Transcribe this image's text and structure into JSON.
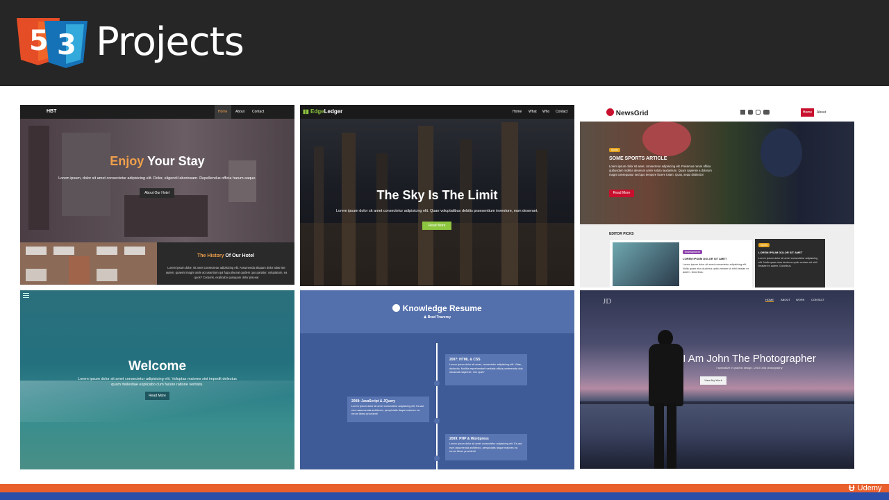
{
  "header": {
    "title": "Projects",
    "logo_html": "5",
    "logo_css": "3"
  },
  "tiles": {
    "hbt": {
      "brand": "HBT",
      "nav": [
        "Home",
        "About",
        "Contact"
      ],
      "hero_accent": "Enjoy",
      "hero_rest": "Your Stay",
      "hero_sub": "Lorem ipsum, dolor sit amet consectetur adipisicing elit. Dolor, eligendi laboriosam. Repellendus officia harum eaque.",
      "button": "About Our Hotel",
      "history_accent": "The History",
      "history_rest": "Of Our Hotel",
      "history_body": "Lorem ipsum dolor, sit amet consectetur adipisicing elit. Assumenda aliquam dolor alias iste autem, quaerat magni unde accusantium qui fuga placeat quidem quo pariatur, voluptatum, ea quos? Corporis, explicabo quisquam dolor placeat"
    },
    "edgeledger": {
      "brand_a": "Edge",
      "brand_b": "Ledger",
      "nav": [
        "Home",
        "What",
        "Who",
        "Contact"
      ],
      "hero": "The Sky Is The Limit",
      "hero_sub": "Lorem ipsum dolor sit amet consectetur adipisicing elit. Quae voluptatibus debitis praesentium inventore, eum deserunt.",
      "button": "Read More"
    },
    "newsgrid": {
      "brand": "NewsGrid",
      "nav_home": "Home",
      "nav_about": "About",
      "tag": "Sports",
      "headline": "SOME SPORTS ARTICLE",
      "body": "Lorem ipsum dolor sit amet, consectetur adipisicing elit. Possimus rerum officia quibusdam mollitia deserunt animi soluta laudantium. Quam sapiente a dolorum magni consequatur sed quo tempore facere totam. Quas, sequi distinctio!",
      "button": "Read More",
      "editor_picks": "EDITOR PICKS",
      "card1_tag": "Entertainment",
      "card1_title": "LOREM IPSUM DOLOR SIT AMET",
      "card1_body": "Lorem ipsum dolor sit amet consectetur adipisicing elit. Nulla quam eius ducimus optio veniam sit nihil beatae ex autem. Doloribus.",
      "card2_tag": "Sports",
      "card2_title": "LOREM IPSUM DOLOR SIT AMET",
      "card2_body": "Lorem ipsum dolor sit amet consectetur adipisicing elit. Nulla quam eius ducimus optio veniam sit nihil beatae ex autem. Doloribus."
    },
    "welcome": {
      "hero": "Welcome",
      "hero_sub": "Lorem ipsum dolor sit amet consectetur adipisicing elit. Voluptas maiores sint impedit delectus quam molestiae explicabo cum facere ratione veritatis.",
      "button": "Read More"
    },
    "resume": {
      "title": "Knowledge Resume",
      "author": "Brad Traversy",
      "entries": [
        {
          "title": "2007: HTML & CSS",
          "body": "Lorem ipsum dolor sit amet, consectetur adipisicing elit. Vitae, distinctio. Mollitia reprehenderit veritatis officia perferendis dolo obcaecati sapiente, rem quia?"
        },
        {
          "title": "2008: JavaScript & JQuery",
          "body": "Lorem ipsum dolor sit amet consectetur adipisicing elit. Ea aut eum assumenda architecto, perspiciatis itaque maiores ea rerum libero provident!"
        },
        {
          "title": "2009: PHP & Wordpress",
          "body": "Lorem ipsum dolor sit amet consectetur adipisicing elit. Ea aut eum assumenda architecto, perspiciatis itaque maiores ea rerum libero provident!"
        }
      ]
    },
    "photographer": {
      "brand": "JD",
      "nav": [
        "HOME",
        "ABOUT",
        "WORK",
        "CONTACT"
      ],
      "hero": "I Am John The Photographer",
      "hero_sub": "I specialize in graphic design, UI/UX and photography",
      "button": "View My Work"
    }
  },
  "footer": {
    "brand": "Udemy"
  },
  "colors": {
    "header_bg": "#262626",
    "html5": "#e44d26",
    "css3": "#2965f1",
    "footer_orange": "#e9602d",
    "footer_blue": "#2b4fa8",
    "orange_accent": "#f0a04b",
    "green_btn": "#8dc63f",
    "news_red": "#c8102e"
  }
}
